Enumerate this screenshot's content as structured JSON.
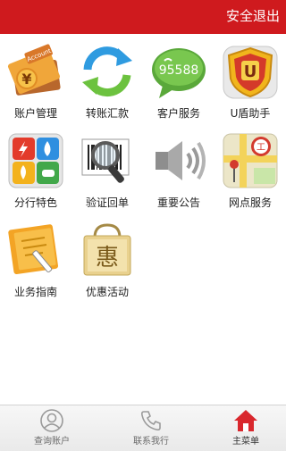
{
  "header": {
    "logout_label": "安全退出",
    "background_color": "#cf1a1e"
  },
  "grid": {
    "items": [
      {
        "label": "账户管理",
        "icon": "account-book-icon",
        "badge": "Account"
      },
      {
        "label": "转账汇款",
        "icon": "refresh-arrows-icon"
      },
      {
        "label": "客户服务",
        "icon": "phone-bubble-icon",
        "badge": "95588"
      },
      {
        "label": "U盾助手",
        "icon": "u-shield-icon",
        "badge": "U"
      },
      {
        "label": "分行特色",
        "icon": "utility-tiles-icon"
      },
      {
        "label": "验证回单",
        "icon": "barcode-magnifier-icon"
      },
      {
        "label": "重要公告",
        "icon": "speaker-icon"
      },
      {
        "label": "网点服务",
        "icon": "map-pin-icon"
      },
      {
        "label": "业务指南",
        "icon": "notepad-pen-icon"
      },
      {
        "label": "优惠活动",
        "icon": "shopping-bag-icon",
        "badge": "惠"
      }
    ]
  },
  "tabbar": {
    "tabs": [
      {
        "label": "查询账户",
        "icon": "user-icon",
        "active": false
      },
      {
        "label": "联系我行",
        "icon": "phone-icon",
        "active": false
      },
      {
        "label": "主菜单",
        "icon": "home-icon",
        "active": true
      }
    ]
  },
  "colors": {
    "accent": "#cf1a1e",
    "home_icon": "#d9272d",
    "tab_icon": "#9a9a9a"
  }
}
